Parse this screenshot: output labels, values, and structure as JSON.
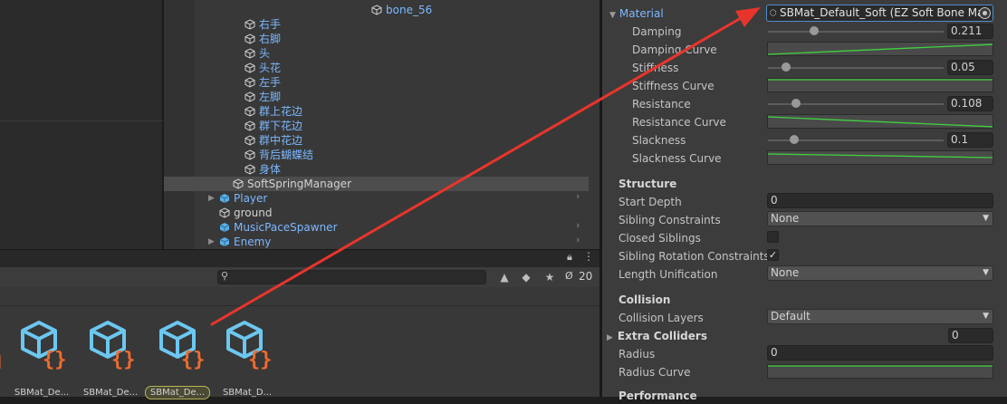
{
  "hierarchy": {
    "rows": [
      {
        "label": "bone_56",
        "color": "blue"
      },
      {
        "label": "右手",
        "color": "blue"
      },
      {
        "label": "右脚",
        "color": "blue"
      },
      {
        "label": "头",
        "color": "blue"
      },
      {
        "label": "头花",
        "color": "blue"
      },
      {
        "label": "左手",
        "color": "blue"
      },
      {
        "label": "左脚",
        "color": "blue"
      },
      {
        "label": "群上花边",
        "color": "blue"
      },
      {
        "label": "群下花边",
        "color": "blue"
      },
      {
        "label": "群中花边",
        "color": "blue"
      },
      {
        "label": "背后蝴蝶结",
        "color": "blue"
      },
      {
        "label": "身体",
        "color": "blue"
      },
      {
        "label": "SoftSpringManager",
        "color": "white"
      },
      {
        "label": "Player",
        "color": "blue"
      },
      {
        "label": "ground",
        "color": "white"
      },
      {
        "label": "MusicPaceSpawner",
        "color": "blue"
      },
      {
        "label": "Enemy",
        "color": "blue"
      }
    ]
  },
  "project": {
    "hidden_count": "20",
    "assets": [
      {
        "name": "SBMat_De..."
      },
      {
        "name": "SBMat_De..."
      },
      {
        "name": "SBMat_De..."
      },
      {
        "name": "SBMat_D..."
      }
    ]
  },
  "inspector": {
    "material": {
      "label": "Material",
      "value": "SBMat_Default_Soft (EZ Soft Bone Mat"
    },
    "damping": {
      "label": "Damping",
      "value": "0.211",
      "fraction": 0.211
    },
    "damping_curve": {
      "label": "Damping Curve"
    },
    "stiffness": {
      "label": "Stiffness",
      "value": "0.05",
      "fraction": 0.05
    },
    "stiffness_curve": {
      "label": "Stiffness Curve"
    },
    "resistance": {
      "label": "Resistance",
      "value": "0.108",
      "fraction": 0.108
    },
    "resistance_curve": {
      "label": "Resistance Curve"
    },
    "slackness": {
      "label": "Slackness",
      "value": "0.1",
      "fraction": 0.1
    },
    "slackness_curve": {
      "label": "Slackness Curve"
    },
    "structure": {
      "header": "Structure",
      "start_depth": {
        "label": "Start Depth",
        "value": "0"
      },
      "sibling_constraints": {
        "label": "Sibling Constraints",
        "value": "None"
      },
      "closed_siblings": {
        "label": "Closed Siblings",
        "checked": false
      },
      "sibling_rotation_constraints": {
        "label": "Sibling Rotation Constraints",
        "checked": true
      },
      "length_unification": {
        "label": "Length Unification",
        "value": "None"
      }
    },
    "collision": {
      "header": "Collision",
      "collision_layers": {
        "label": "Collision Layers",
        "value": "Default"
      },
      "extra_colliders": {
        "label": "Extra Colliders",
        "value": "0"
      },
      "radius": {
        "label": "Radius",
        "value": "0"
      },
      "radius_curve": {
        "label": "Radius Curve"
      }
    },
    "performance": {
      "header": "Performance"
    }
  },
  "colors": {
    "accent_blue": "#7cb8ff",
    "curve_green": "#3fd13f",
    "annotation_red": "#e8352c",
    "asset_icon_blue": "#6cc7f0",
    "asset_icon_orange": "#f06b2e"
  }
}
